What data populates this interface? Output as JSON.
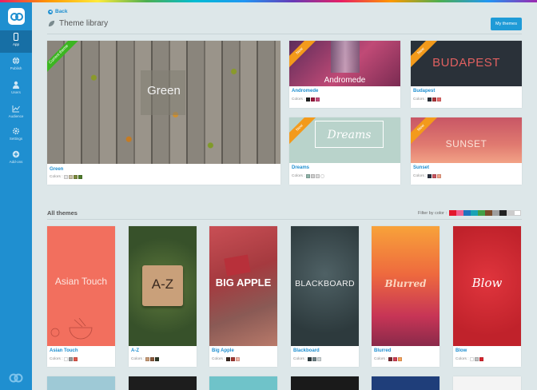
{
  "sidebar": {
    "items": [
      {
        "label": "App",
        "icon": "phone-icon"
      },
      {
        "label": "Publish",
        "icon": "globe-icon"
      },
      {
        "label": "Users",
        "icon": "users-icon"
      },
      {
        "label": "Audience",
        "icon": "chart-icon"
      },
      {
        "label": "Settings",
        "icon": "gear-icon"
      },
      {
        "label": "Add-ons",
        "icon": "plus-circle-icon"
      }
    ]
  },
  "header": {
    "back_label": "Back",
    "title": "Theme library",
    "my_themes_label": "My themes"
  },
  "library": {
    "colors_label": "Colors :",
    "current_ribbon": "Current theme",
    "new_ribbon": "New",
    "featured": [
      {
        "name": "Green",
        "image_text": "Green",
        "swatches": [
          "#e6e6e6",
          "#c9c0a5",
          "#7d8a3e",
          "#4f7d2c"
        ]
      },
      {
        "name": "Andromede",
        "image_text": "Andromede",
        "swatches": [
          "#222222",
          "#9c1b3f",
          "#c44c7c"
        ]
      },
      {
        "name": "Budapest",
        "image_text": "BUDAPEST",
        "swatches": [
          "#2a2f38",
          "#b0353a",
          "#e56a6a"
        ]
      },
      {
        "name": "Dreams",
        "image_text": "Dreams",
        "swatches": [
          "#8fb3a8",
          "#cfcfcf",
          "#dcdcdc",
          "#ffffff"
        ]
      },
      {
        "name": "Sunset",
        "image_text": "SUNSET",
        "swatches": [
          "#2a3040",
          "#c85560",
          "#f2a286"
        ]
      }
    ]
  },
  "all_themes": {
    "title": "All themes",
    "filter_label": "Filter by color :",
    "filter_colors": [
      "#e3182d",
      "#f06292",
      "#1e73be",
      "#1aa3b5",
      "#43a047",
      "#7b4b2a",
      "#9e9e9e",
      "#222222",
      "#cccccc",
      "#ffffff"
    ],
    "themes": [
      {
        "name": "Asian Touch",
        "image_text": "Asian Touch",
        "swatches": [
          "#ffffff",
          "#9a9a9a",
          "#e0584b"
        ]
      },
      {
        "name": "A-Z",
        "image_text": "A-Z",
        "swatches": [
          "#c89b76",
          "#8a5a3c",
          "#2f3a27"
        ]
      },
      {
        "name": "Big Apple",
        "image_text": "BIG APPLE",
        "swatches": [
          "#3b2a22",
          "#a33a33",
          "#f2b4a6"
        ]
      },
      {
        "name": "Blackboard",
        "image_text": "BLACKBOARD",
        "swatches": [
          "#2f3e41",
          "#6e8185",
          "#cfd6d7"
        ]
      },
      {
        "name": "Blurred",
        "image_text": "Blurred",
        "swatches": [
          "#7a2a2f",
          "#cf3f54",
          "#f7a35a"
        ]
      },
      {
        "name": "Blow",
        "image_text": "Blow",
        "swatches": [
          "#ffffff",
          "#c0c0c0",
          "#d9262e"
        ]
      }
    ]
  }
}
